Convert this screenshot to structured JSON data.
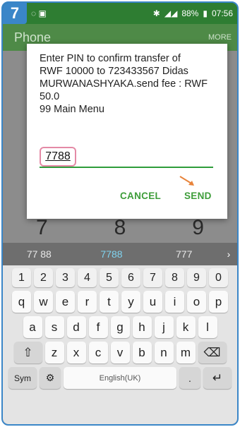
{
  "step": "7",
  "status": {
    "battery": "88%",
    "time": "07:56"
  },
  "appbar": {
    "title": "Phone",
    "more": "MORE"
  },
  "dialog": {
    "message": "Enter PIN to confirm transfer of\nRWF 10000 to 723433567 Didas\nMURWANASHYAKA.send fee : RWF\n50.0\n99 Main Menu",
    "pin_value": "7788",
    "cancel_label": "CANCEL",
    "send_label": "SEND"
  },
  "dialer_digits": [
    "7",
    "8",
    "9"
  ],
  "suggestions": [
    "77 88",
    "7788",
    "777"
  ],
  "keyboard": {
    "number_row": [
      "1",
      "2",
      "3",
      "4",
      "5",
      "6",
      "7",
      "8",
      "9",
      "0"
    ],
    "row1": [
      "q",
      "w",
      "e",
      "r",
      "t",
      "y",
      "u",
      "i",
      "o",
      "p"
    ],
    "row2": [
      "a",
      "s",
      "d",
      "f",
      "g",
      "h",
      "j",
      "k",
      "l"
    ],
    "row3": [
      "z",
      "x",
      "c",
      "v",
      "b",
      "n",
      "m"
    ],
    "sym_label": "Sym",
    "space_label": "English(UK)",
    "punct_label": "."
  },
  "colors": {
    "accent": "#3a86c8",
    "green": "#3e9d3a",
    "pin_highlight": "#e48aa6"
  }
}
